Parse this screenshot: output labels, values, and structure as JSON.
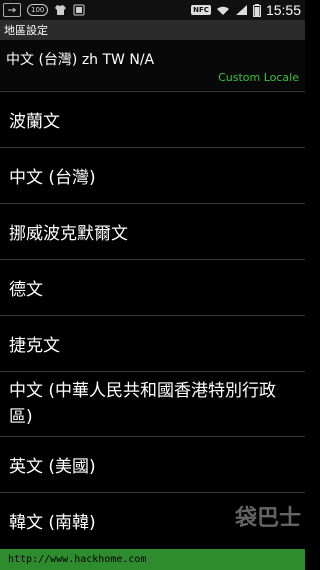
{
  "status_bar": {
    "badge": "100",
    "nfc": "NFC",
    "time": "15:55"
  },
  "title": "地區設定",
  "current_locale": "中文 (台灣)  zh TW N/A",
  "custom_locale": "Custom Locale",
  "locales": [
    "波蘭文",
    "中文 (台灣)",
    "挪威波克默爾文",
    "德文",
    "捷克文",
    "中文 (中華人民共和國香港特別行政區)",
    "英文 (美國)",
    "韓文 (南韓)"
  ],
  "bottom_bar": {
    "url": "http://www.hackhome.com"
  },
  "watermark": {
    "logo": "袋巴士"
  },
  "icons": [
    "usb-icon",
    "shirt-icon",
    "nfc-icon",
    "wifi-icon",
    "signal-icon",
    "battery-icon"
  ],
  "colors": {
    "accent": "#37c437",
    "bottom_bar": "#2e8c2e"
  }
}
